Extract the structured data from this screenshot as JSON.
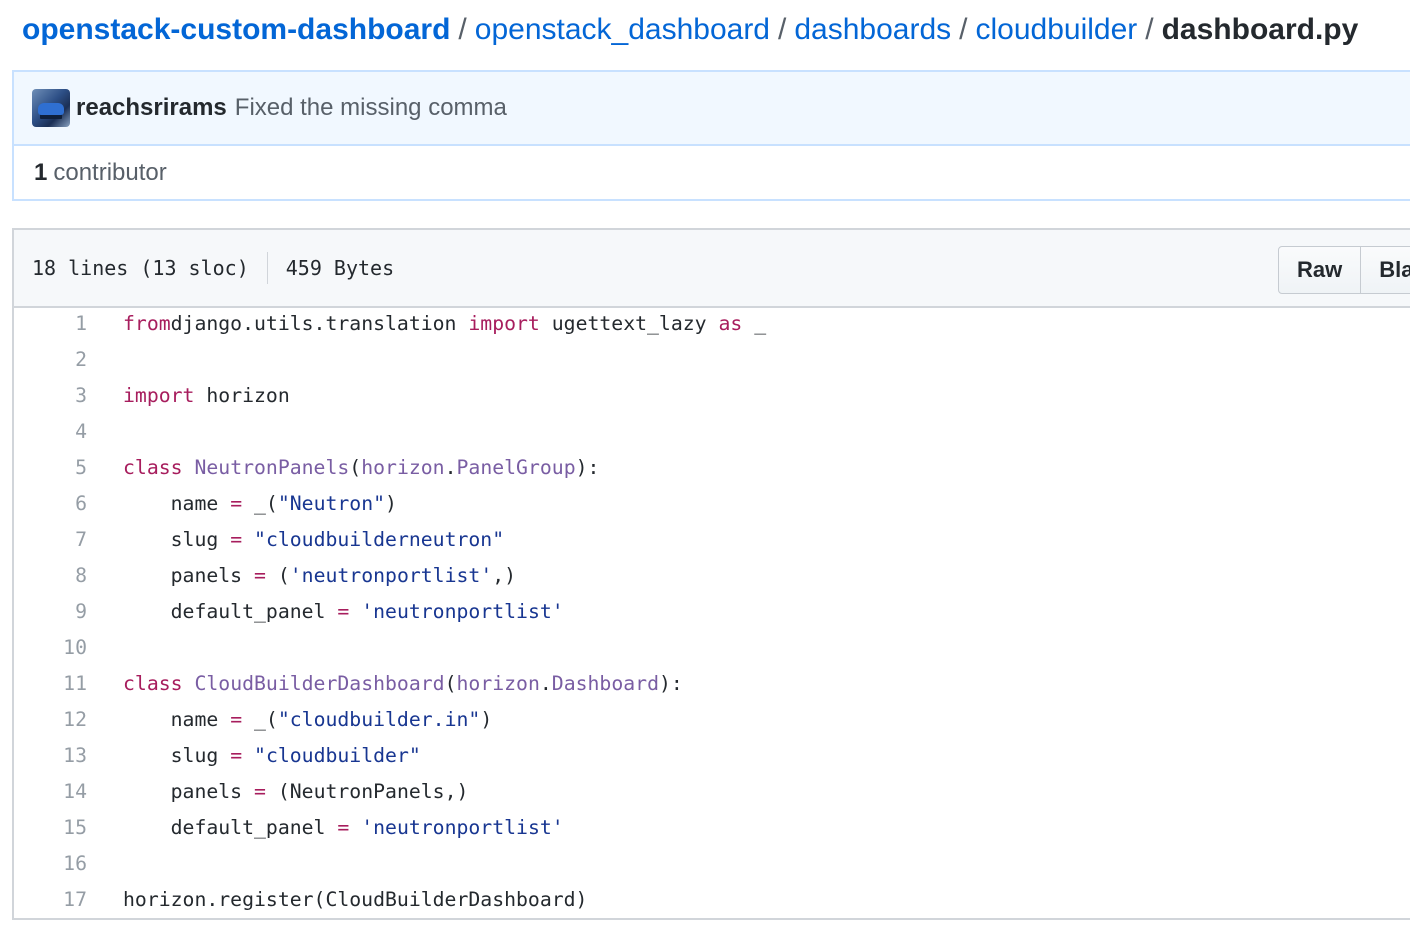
{
  "breadcrumb": {
    "repo": "openstack-custom-dashboard",
    "path": [
      "openstack_dashboard",
      "dashboards",
      "cloudbuilder"
    ],
    "file": "dashboard.py",
    "separator": "/"
  },
  "commit": {
    "author": "reachsrirams",
    "message": "Fixed the missing comma"
  },
  "contributors": {
    "count": "1",
    "label": "contributor"
  },
  "file_info": {
    "lines": "18 lines (13 sloc)",
    "size": "459 Bytes"
  },
  "buttons": {
    "raw": "Raw",
    "blame": "Blame"
  },
  "code_lines": [
    {
      "n": "1",
      "tokens": [
        [
          "kw",
          "from"
        ],
        [
          "",
          "django.utils.translation "
        ],
        [
          "kw",
          "import"
        ],
        [
          "",
          " ugettext_lazy "
        ],
        [
          "kw",
          "as"
        ],
        [
          "",
          " _"
        ]
      ]
    },
    {
      "n": "2",
      "tokens": []
    },
    {
      "n": "3",
      "tokens": [
        [
          "kw",
          "import"
        ],
        [
          "",
          " horizon"
        ]
      ]
    },
    {
      "n": "4",
      "tokens": []
    },
    {
      "n": "5",
      "tokens": [
        [
          "kw",
          "class"
        ],
        [
          "",
          " "
        ],
        [
          "ent",
          "NeutronPanels"
        ],
        [
          "",
          "("
        ],
        [
          "ent",
          "horizon"
        ],
        [
          "",
          "."
        ],
        [
          "ent",
          "PanelGroup"
        ],
        [
          "",
          "):"
        ]
      ]
    },
    {
      "n": "6",
      "tokens": [
        [
          "",
          "    name "
        ],
        [
          "kw",
          "="
        ],
        [
          "",
          " _("
        ],
        [
          "str",
          "\"Neutron\""
        ],
        [
          "",
          ")"
        ]
      ]
    },
    {
      "n": "7",
      "tokens": [
        [
          "",
          "    slug "
        ],
        [
          "kw",
          "="
        ],
        [
          "",
          " "
        ],
        [
          "str",
          "\"cloudbuilderneutron\""
        ]
      ]
    },
    {
      "n": "8",
      "tokens": [
        [
          "",
          "    panels "
        ],
        [
          "kw",
          "="
        ],
        [
          "",
          " ("
        ],
        [
          "str",
          "'neutronportlist'"
        ],
        [
          "",
          ",)"
        ]
      ]
    },
    {
      "n": "9",
      "tokens": [
        [
          "",
          "    default_panel "
        ],
        [
          "kw",
          "="
        ],
        [
          "",
          " "
        ],
        [
          "str",
          "'neutronportlist'"
        ]
      ]
    },
    {
      "n": "10",
      "tokens": []
    },
    {
      "n": "11",
      "tokens": [
        [
          "kw",
          "class"
        ],
        [
          "",
          " "
        ],
        [
          "ent",
          "CloudBuilderDashboard"
        ],
        [
          "",
          "("
        ],
        [
          "ent",
          "horizon"
        ],
        [
          "",
          "."
        ],
        [
          "ent",
          "Dashboard"
        ],
        [
          "",
          "):"
        ]
      ]
    },
    {
      "n": "12",
      "tokens": [
        [
          "",
          "    name "
        ],
        [
          "kw",
          "="
        ],
        [
          "",
          " _("
        ],
        [
          "str",
          "\"cloudbuilder.in\""
        ],
        [
          "",
          ")"
        ]
      ]
    },
    {
      "n": "13",
      "tokens": [
        [
          "",
          "    slug "
        ],
        [
          "kw",
          "="
        ],
        [
          "",
          " "
        ],
        [
          "str",
          "\"cloudbuilder\""
        ]
      ]
    },
    {
      "n": "14",
      "tokens": [
        [
          "",
          "    panels "
        ],
        [
          "kw",
          "="
        ],
        [
          "",
          " (NeutronPanels,)"
        ]
      ]
    },
    {
      "n": "15",
      "tokens": [
        [
          "",
          "    default_panel "
        ],
        [
          "kw",
          "="
        ],
        [
          "",
          " "
        ],
        [
          "str",
          "'neutronportlist'"
        ]
      ]
    },
    {
      "n": "16",
      "tokens": []
    },
    {
      "n": "17",
      "tokens": [
        [
          "",
          "horizon.register(CloudBuilderDashboard)"
        ]
      ]
    }
  ]
}
